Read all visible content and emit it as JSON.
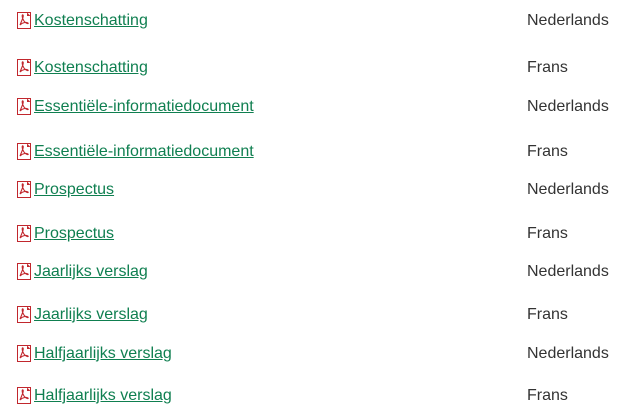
{
  "documents": [
    {
      "title": "Kostenschatting",
      "language": "Nederlands",
      "icon": "pdf-icon"
    },
    {
      "title": "Kostenschatting",
      "language": "Frans",
      "icon": "pdf-icon"
    },
    {
      "title": "Essentiële-informatiedocument",
      "language": "Nederlands",
      "icon": "pdf-icon"
    },
    {
      "title": "Essentiële-informatiedocument",
      "language": "Frans",
      "icon": "pdf-icon"
    },
    {
      "title": "Prospectus",
      "language": "Nederlands",
      "icon": "pdf-icon"
    },
    {
      "title": "Prospectus",
      "language": "Frans",
      "icon": "pdf-icon"
    },
    {
      "title": "Jaarlijks verslag",
      "language": "Nederlands",
      "icon": "pdf-icon"
    },
    {
      "title": "Jaarlijks verslag",
      "language": "Frans",
      "icon": "pdf-icon"
    },
    {
      "title": "Halfjaarlijks verslag",
      "language": "Nederlands",
      "icon": "pdf-icon"
    },
    {
      "title": "Halfjaarlijks verslag",
      "language": "Frans",
      "icon": "pdf-icon"
    }
  ],
  "colors": {
    "link": "#0f7f50",
    "text": "#333333",
    "pdf_icon": "#c1272d"
  }
}
